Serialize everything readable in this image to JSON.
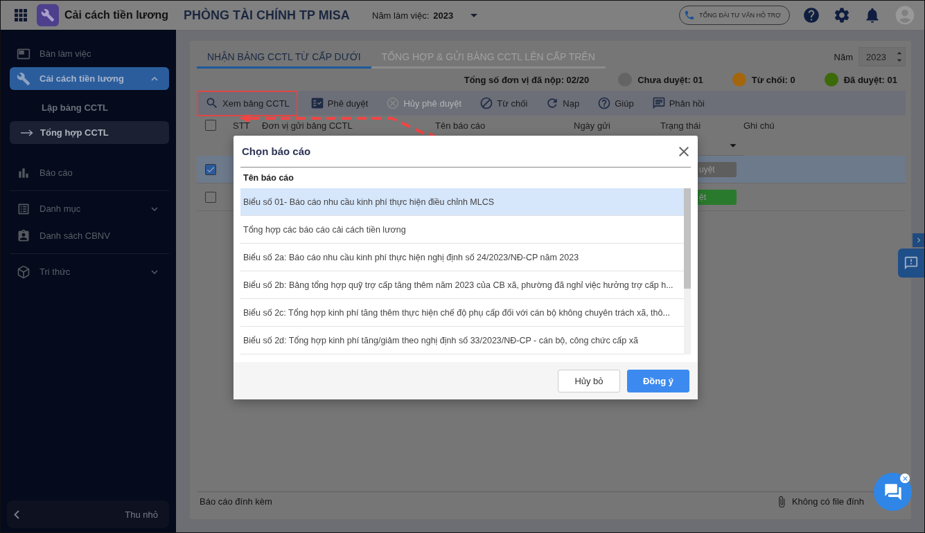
{
  "app": {
    "title": "Cải cách tiền lương"
  },
  "header": {
    "org": "PHÒNG TÀI CHÍNH TP MISA",
    "year_label": "Năm làm việc:",
    "year": "2023",
    "hotline": "TỔNG ĐÀI TƯ VẤN HỖ TRỢ"
  },
  "sidebar": {
    "groups": [
      {
        "items": [
          {
            "label": "Bàn làm việc",
            "selected": false
          },
          {
            "label": "Cải cách tiền lương",
            "selected": true,
            "expanded": true,
            "children": [
              {
                "label": "Lập bảng CCTL",
                "selected": false
              },
              {
                "label": "Tổng hợp CCTL",
                "selected": true
              }
            ]
          },
          {
            "label": "Báo cáo",
            "selected": false
          }
        ]
      },
      {
        "items": [
          {
            "label": "Danh mục",
            "selected": false,
            "expanded": false
          },
          {
            "label": "Danh sách CBNV",
            "selected": false
          }
        ]
      },
      {
        "items": [
          {
            "label": "Tri thức",
            "selected": false,
            "expanded": false
          }
        ]
      }
    ],
    "collapse": "Thu nhỏ"
  },
  "tabs": [
    {
      "label": "NHẬN BẢNG CCTL TỪ CẤP DƯỚI",
      "selected": true
    },
    {
      "label": "TỔNG HỢP & GỬI BẢNG CCTL LÊN CẤP TRÊN",
      "selected": false
    }
  ],
  "year_picker": {
    "label": "Năm",
    "value": "2023"
  },
  "summary": {
    "total": "Tổng số đơn vị đã nộp: 02/20",
    "statuses": [
      {
        "label": "Chưa duyệt: 01",
        "color": "#646464"
      },
      {
        "label": "Từ chối: 0",
        "color": "#a4660c"
      },
      {
        "label": "Đã duyệt: 01",
        "color": "#3d6a08"
      }
    ]
  },
  "toolbar": [
    {
      "label": "Xem bảng CCTL",
      "disabled": false,
      "highlighted": true
    },
    {
      "label": "Phê duyệt",
      "disabled": false,
      "highlighted": false
    },
    {
      "label": "Hủy phê duyệt",
      "disabled": true,
      "highlighted": false
    },
    {
      "label": "Từ chối",
      "disabled": false,
      "highlighted": false
    },
    {
      "label": "Nạp",
      "disabled": false,
      "highlighted": false
    },
    {
      "label": "Giúp",
      "disabled": false,
      "highlighted": false
    },
    {
      "label": "Phản hồi",
      "disabled": false,
      "highlighted": false
    }
  ],
  "table": {
    "all_checked": false,
    "columns": [
      "STT",
      "Đơn vị gửi bảng CCTL",
      "Tên báo cáo",
      "Ngày gửi",
      "Trạng thái",
      "Ghi chú"
    ],
    "rows": [
      {
        "selected": true,
        "checked": true,
        "status": "uyệt",
        "color": "#5e5e5e"
      },
      {
        "selected": false,
        "checked": false,
        "status": "ệt",
        "color": "#2a7a2e"
      }
    ]
  },
  "attachments": {
    "label": "Báo cáo đính kèm",
    "files": "Không có file đính"
  },
  "dialog": {
    "title": "Chọn báo cáo",
    "column": "Tên báo cáo",
    "rows": [
      {
        "label": "Biểu số 01- Báo cáo nhu cầu kinh phí thực hiện điều chỉnh MLCS",
        "selected": true
      },
      {
        "label": "Tổng hợp các báo cáo cải cách tiền lương",
        "selected": false
      },
      {
        "label": "Biểu số 2a: Báo cáo nhu cầu kinh phí thực hiện nghị định số 24/2023/NĐ-CP năm 2023",
        "selected": false
      },
      {
        "label": "Biểu số 2b: Bảng tổng hợp quỹ trợ cấp tăng thêm năm 2023 của CB xã, phường đã nghỉ việc hưởng trợ cấp h...",
        "selected": false
      },
      {
        "label": "Biểu số 2c: Tổng hợp kinh phí tăng thêm thực hiện chế độ phụ cấp đối với cán bộ không chuyên trách xã, thô...",
        "selected": false
      },
      {
        "label": "Biểu số 2d: Tổng hợp kinh phí tăng/giảm theo nghị định số 33/2023/NĐ-CP - cán bộ, công chức cấp xã",
        "selected": false
      }
    ],
    "buttons": [
      {
        "label": "Hủy bỏ",
        "kind": "secondary"
      },
      {
        "label": "Đồng ý",
        "kind": "primary"
      }
    ]
  }
}
